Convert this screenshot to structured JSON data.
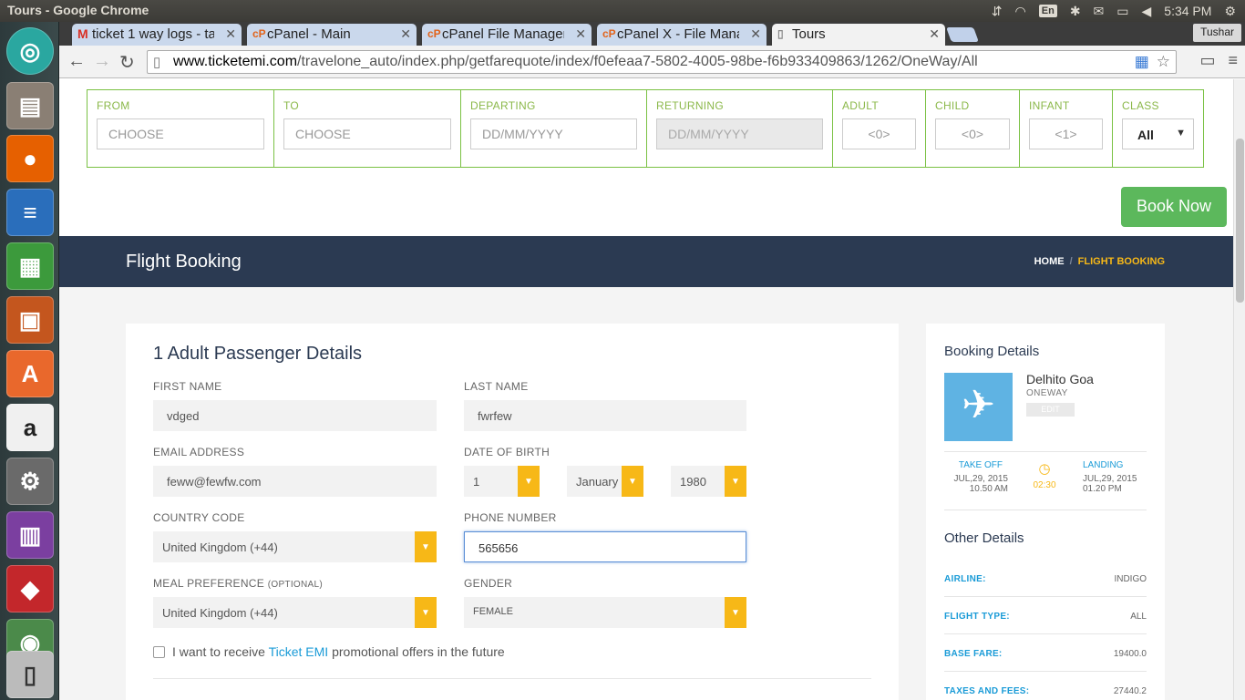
{
  "os": {
    "window_title": "Tours - Google Chrome",
    "keyboard": "En",
    "clock": "5:34 PM"
  },
  "chrome": {
    "tabs": [
      {
        "label": "ticket 1 way logs - ta",
        "icon": "gmail-icon"
      },
      {
        "label": "cPanel - Main",
        "icon": "cpanel-icon"
      },
      {
        "label": "cPanel File Manager",
        "icon": "cpanel-icon"
      },
      {
        "label": "cPanel X - File Manag",
        "icon": "cpanel-icon"
      },
      {
        "label": "Tours",
        "icon": "page-icon"
      }
    ],
    "profile": "Tushar",
    "url_host": "www.ticketemi.com",
    "url_path": "/travelone_auto/index.php/getfarequote/index/f0efeaa7-5802-4005-98be-f6b933409863/1262/OneWay/All"
  },
  "search": {
    "from_label": "FROM",
    "from_placeholder": "CHOOSE",
    "to_label": "TO",
    "to_placeholder": "CHOOSE",
    "departing_label": "DEPARTING",
    "departing_placeholder": "DD/MM/YYYY",
    "returning_label": "RETURNING",
    "returning_placeholder": "DD/MM/YYYY",
    "adult_label": "ADULT",
    "adult_placeholder": "<0>",
    "child_label": "CHILD",
    "child_placeholder": "<0>",
    "infant_label": "INFANT",
    "infant_placeholder": "<1>",
    "class_label": "CLASS",
    "class_value": "All"
  },
  "book_now": "Book Now",
  "header": {
    "title": "Flight Booking",
    "crumb_home": "HOME",
    "crumb_current": "FLIGHT BOOKING"
  },
  "passenger": {
    "title": "1 Adult Passenger Details",
    "first_name_label": "FIRST NAME",
    "first_name": "vdged",
    "last_name_label": "LAST NAME",
    "last_name": "fwrfew",
    "email_label": "EMAIL ADDRESS",
    "email": "feww@fewfw.com",
    "dob_label": "DATE OF BIRTH",
    "dob_day": "1",
    "dob_month": "January",
    "dob_year": "1980",
    "country_code_label": "COUNTRY CODE",
    "country_code": "United Kingdom (+44)",
    "phone_label": "PHONE NUMBER",
    "phone": "565656",
    "meal_label": "MEAL PREFERENCE",
    "meal_optional": "(OPTIONAL)",
    "meal": "United Kingdom (+44)",
    "gender_label": "GENDER",
    "gender": "FEMALE",
    "promo_text_before": "I want to receive",
    "promo_link": "Ticket EMI",
    "promo_text_after": "promotional offers in the future"
  },
  "booking": {
    "title": "Booking Details",
    "route": "Delhito Goa",
    "trip_type": "ONEWAY",
    "edit": "EDIT",
    "takeoff_label": "TAKE OFF",
    "takeoff_date": "JUL,29, 2015",
    "takeoff_time": "10.50 AM",
    "duration": "02:30",
    "landing_label": "LANDING",
    "landing_date": "JUL,29, 2015",
    "landing_time": "01.20 PM",
    "other_title": "Other Details",
    "rows": [
      {
        "key": "AIRLINE:",
        "value": "INDIGO"
      },
      {
        "key": "FLIGHT TYPE:",
        "value": "ALL"
      },
      {
        "key": "BASE FARE:",
        "value": "19400.0"
      },
      {
        "key": "TAXES AND FEES:",
        "value": "27440.2"
      }
    ]
  },
  "colors": {
    "accent_yellow": "#f7b817",
    "header_navy": "#2b3a52",
    "link_blue": "#1a9bd7",
    "form_green": "#7ac143",
    "button_green": "#5cb85c"
  }
}
